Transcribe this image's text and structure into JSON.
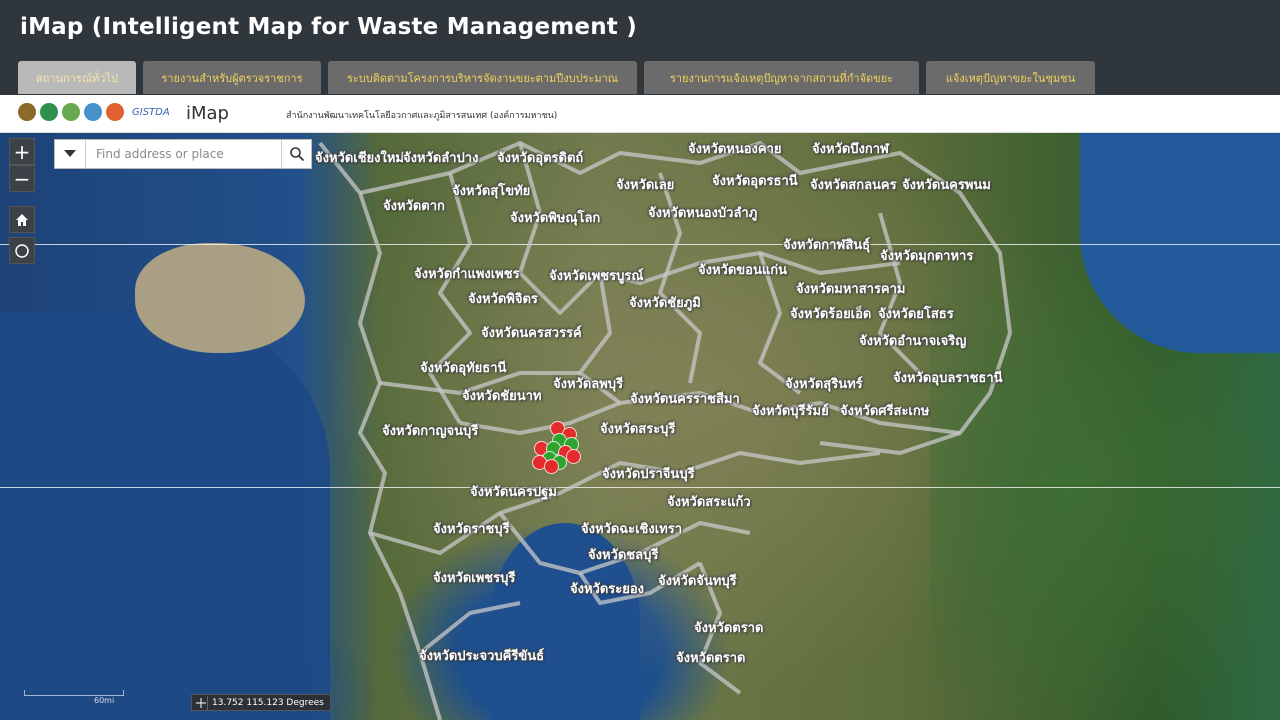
{
  "app": {
    "title": "iMap (Intelligent Map for Waste Management )"
  },
  "tabs": [
    {
      "label": "สถานการณ์ทั่วไป",
      "active": true
    },
    {
      "label": "รายงานสำหรับผู้ตรวจราชการ",
      "active": false
    },
    {
      "label": "ระบบติดตามโครงการบริหารจัดงานขยะตามปีงบประมาณ",
      "active": false
    },
    {
      "label": "รายงานการแจ้งเหตุปัญหาจากสถานที่กำจัดขยะ",
      "active": false
    },
    {
      "label": "แจ้งเหตุปัญหาขยะในชุมชน",
      "active": false
    }
  ],
  "logobar": {
    "gistda": "GISTDA",
    "imap": "iMap",
    "organization": "สำนักงานพัฒนาเทคโนโลยีอวกาศและภูมิสารสนเทศ (องค์การมหาชน)"
  },
  "search": {
    "placeholder": "Find address or place",
    "value": ""
  },
  "controls": {
    "zoom_in": "+",
    "zoom_out": "−"
  },
  "map": {
    "provinces": [
      "จังหวัดเชียงใหม่",
      "จังหวัดลำปาง",
      "จังหวัดอุตรดิตถ์",
      "จังหวัดหนองคาย",
      "จังหวัดบึงกาฬ",
      "จังหวัดสุโขทัย",
      "จังหวัดเลย",
      "จังหวัดอุดรธานี",
      "จังหวัดสกลนคร",
      "จังหวัดนครพนม",
      "จังหวัดตาก",
      "จังหวัดพิษณุโลก",
      "จังหวัดหนองบัวลำภู",
      "จังหวัดกาฬสินธุ์",
      "จังหวัดมุกดาหาร",
      "จังหวัดกำแพงเพชร",
      "จังหวัดเพชรบูรณ์",
      "จังหวัดขอนแก่น",
      "จังหวัดมหาสารคาม",
      "จังหวัดพิจิตร",
      "จังหวัดชัยภูมิ",
      "จังหวัดร้อยเอ็ด",
      "จังหวัดยโสธร",
      "จังหวัดนครสวรรค์",
      "จังหวัดอำนาจเจริญ",
      "จังหวัดอุทัยธานี",
      "จังหวัดลพบุรี",
      "จังหวัดสุรินทร์",
      "จังหวัดอุบลราชธานี",
      "จังหวัดชัยนาท",
      "จังหวัดนครราชสีมา",
      "จังหวัดบุรีรัมย์",
      "จังหวัดศรีสะเกษ",
      "จังหวัดกาญจนบุรี",
      "จังหวัดสระบุรี",
      "จังหวัดปราจีนบุรี",
      "จังหวัดนครปฐม",
      "จังหวัดสระแก้ว",
      "จังหวัดราชบุรี",
      "จังหวัดฉะเชิงเทรา",
      "จังหวัดชลบุรี",
      "จังหวัดเพชรบุรี",
      "จังหวัดระยอง",
      "จังหวัดจันทบุรี",
      "จังหวัดตราด",
      "จังหวัดตราด",
      "จังหวัดประจวบคีรีขันธ์"
    ],
    "markers": [
      {
        "status": "red"
      },
      {
        "status": "red"
      },
      {
        "status": "green"
      },
      {
        "status": "green"
      },
      {
        "status": "red"
      },
      {
        "status": "green"
      },
      {
        "status": "red"
      },
      {
        "status": "green"
      },
      {
        "status": "red"
      },
      {
        "status": "red"
      },
      {
        "status": "green"
      },
      {
        "status": "red"
      }
    ],
    "scale": "60mi",
    "coordinates": "13.752 115.123 Degrees"
  },
  "colors": {
    "header_bg": "#2f363c",
    "tab_text": "#f2d25a",
    "marker_red": "#e52b2b",
    "marker_green": "#2ea32e"
  }
}
